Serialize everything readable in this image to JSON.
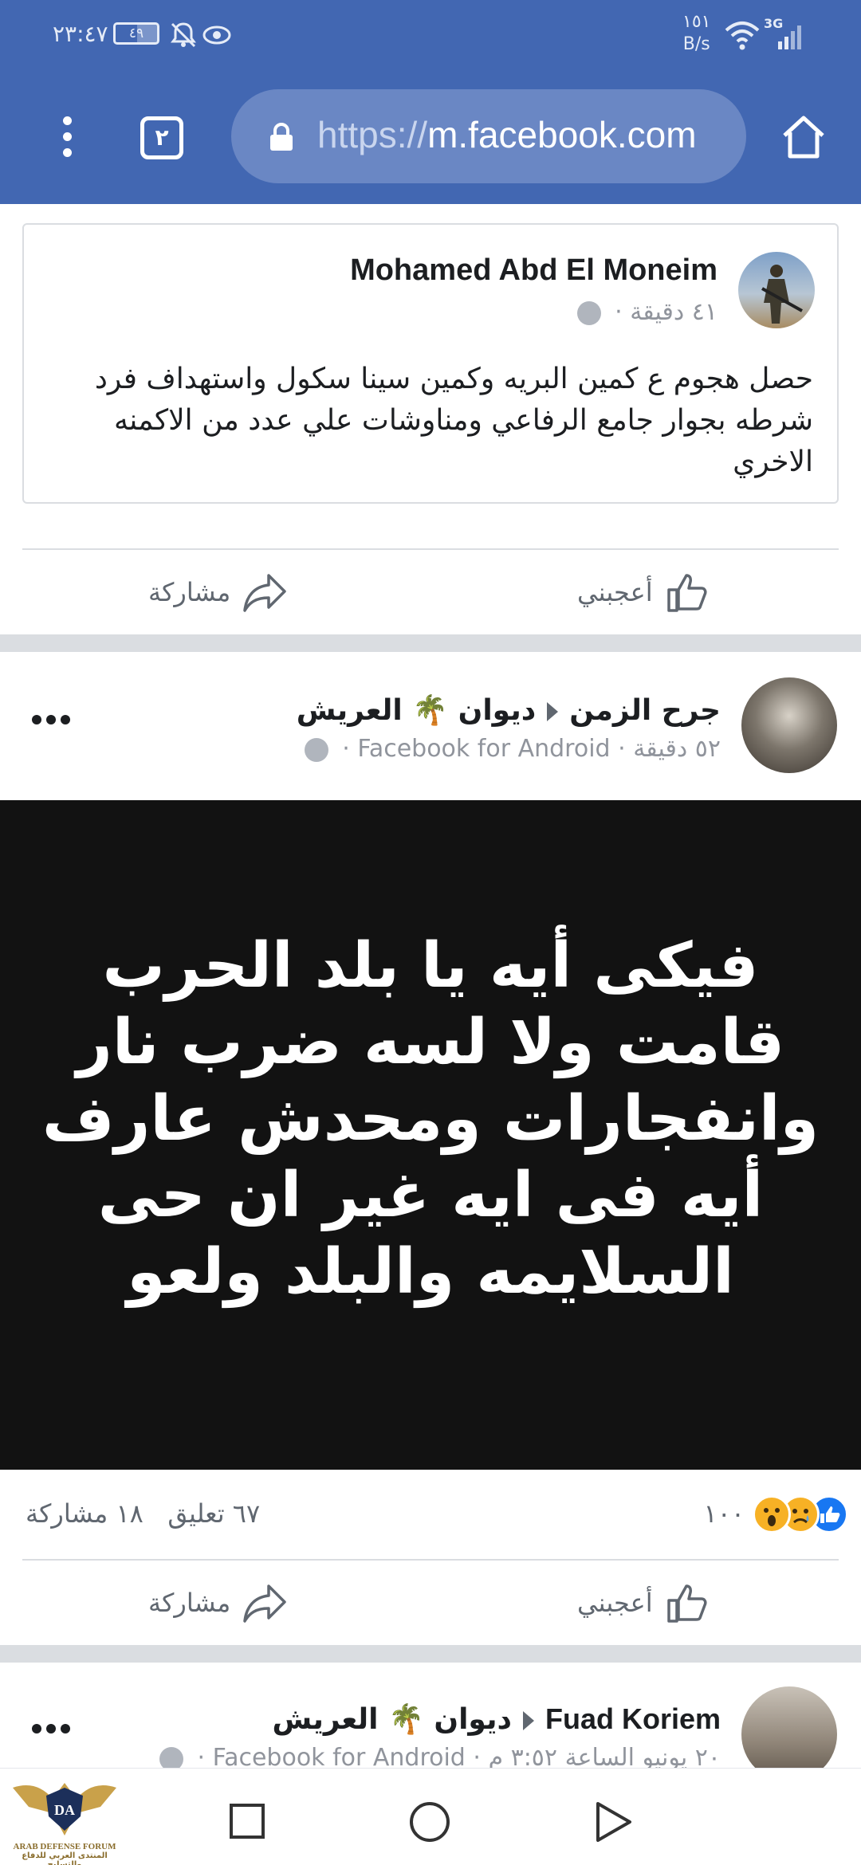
{
  "status_bar": {
    "time": "٢٣:٤٧",
    "battery": "٤٩",
    "net_speed_value": "١٥١",
    "net_speed_unit": "B/s",
    "network": "3G",
    "icons": [
      "battery-icon",
      "bell-off-icon",
      "eye-icon",
      "wifi-icon",
      "signal-icon"
    ]
  },
  "browser": {
    "tab_count": "٢",
    "url_prefix": "https://",
    "url_host": "m.facebook.com",
    "icons": [
      "menu-dots-icon",
      "lock-icon",
      "home-icon"
    ]
  },
  "posts": [
    {
      "author": "Mohamed Abd El Moneim",
      "time": "٤١ دقيقة ·",
      "text": "حصل هجوم ع كمين البريه وكمين سينا سكول واستهداف فرد شرطه بجوار جامع الرفاعي ومناوشات علي عدد من الاكمنه الاخري",
      "like_label": "أعجبني",
      "share_label": "مشاركة"
    },
    {
      "author": "جرح الزمن",
      "group": "ديوان 🌴 العريش",
      "meta": "٥٢ دقيقة · Facebook for Android ·",
      "image_text": "فيكى أيه يا بلد الحرب\nقامت ولا لسه ضرب نار\nوانفجارات ومحدش عارف\nأيه فى ايه غير ان حى\nالسلايمه والبلد ولعو",
      "reactions_count": "١٠٠",
      "comments": "٦٧ تعليق",
      "shares": "١٨ مشاركة",
      "like_label": "أعجبني",
      "share_label": "مشاركة"
    },
    {
      "author": "Fuad Koriem",
      "group": "ديوان 🌴 العريش",
      "meta": "٢٠ يونيو الساعة ٣:٥٢ م · Facebook for Android ·"
    }
  ],
  "watermark": {
    "logo_letters": "DA",
    "line1": "ARAB DEFENSE FORUM",
    "line2": "المنتدى العربي للدفاع والتسليح"
  },
  "colors": {
    "brand": "#4267b2",
    "like_blue": "#1877f2",
    "reaction_yellow": "#f7b125"
  }
}
